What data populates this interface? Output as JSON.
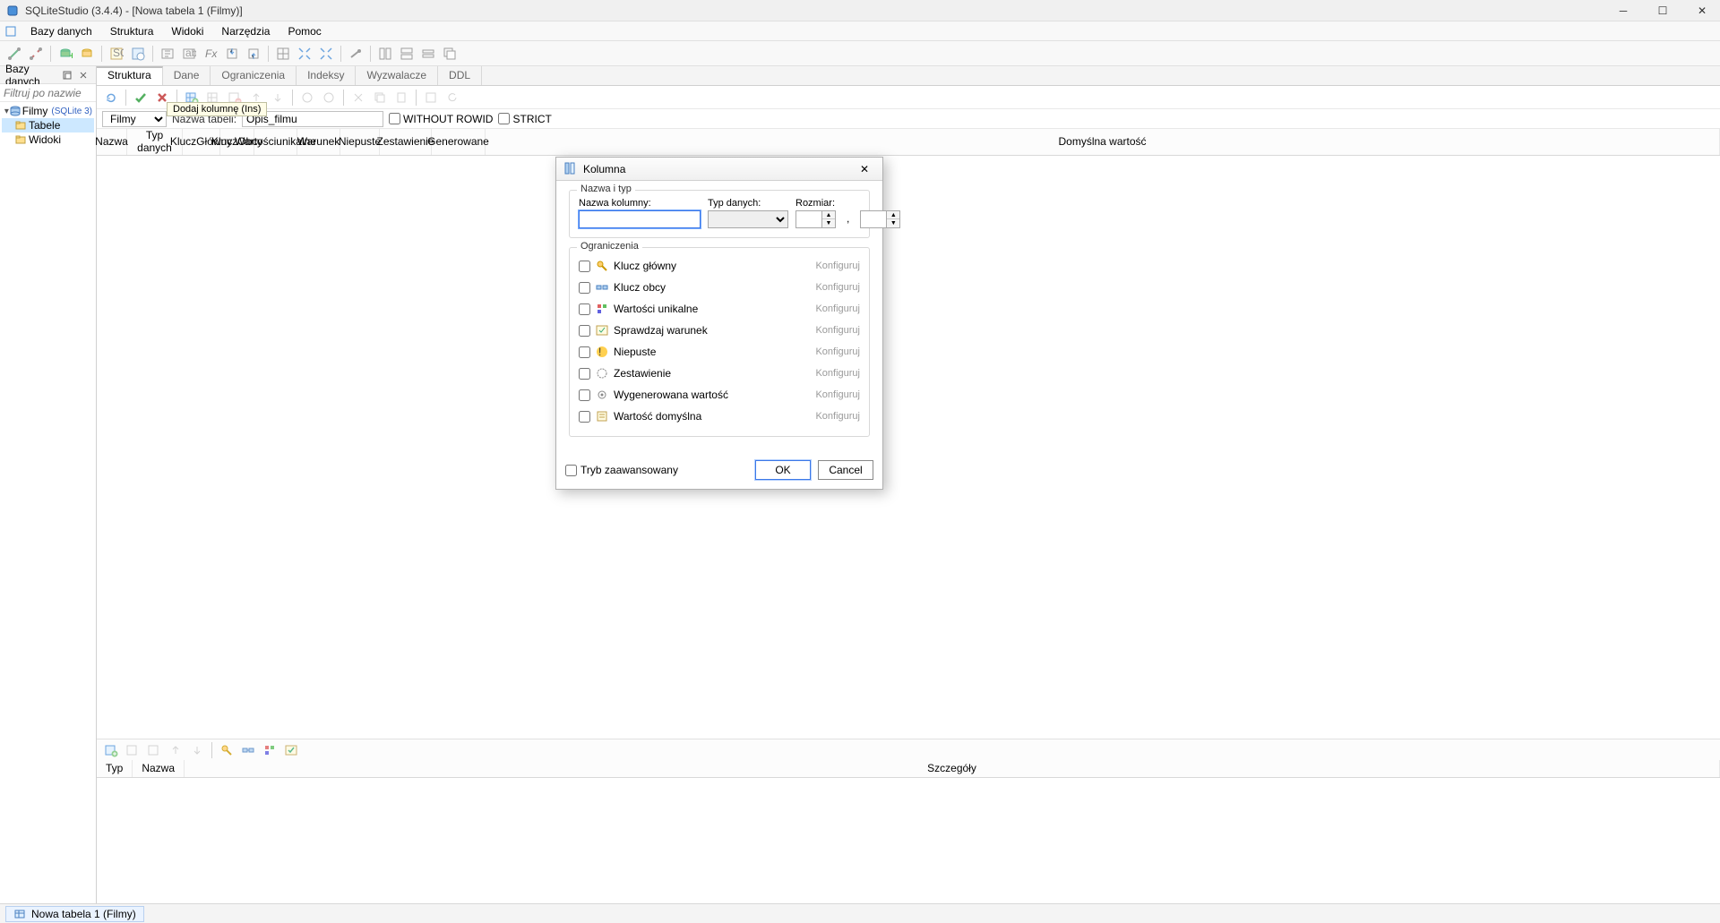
{
  "window": {
    "title": "SQLiteStudio (3.4.4) - [Nowa tabela 1 (Filmy)]"
  },
  "menu": {
    "items": [
      "Bazy danych",
      "Struktura",
      "Widoki",
      "Narzędzia",
      "Pomoc"
    ]
  },
  "sidebar": {
    "title": "Bazy danych",
    "filter_placeholder": "Filtruj po nazwie",
    "db_name": "Filmy",
    "db_type": "(SQLite 3)",
    "node_tables": "Tabele",
    "node_views": "Widoki"
  },
  "editor": {
    "tabs": [
      "Struktura",
      "Dane",
      "Ograniczenia",
      "Indeksy",
      "Wyzwalacze",
      "DDL"
    ],
    "tooltip": "Dodaj kolumnę (Ins)",
    "db_select": "Filmy",
    "table_name_label": "Nazwa tabeli:",
    "table_name_value": "Opis_filmu",
    "without_rowid": "WITHOUT ROWID",
    "strict": "STRICT",
    "col_headers": {
      "nazwa": "Nazwa",
      "typ": "Typ danych",
      "klucz_glowny_1": "Klucz",
      "klucz_glowny_2": "Główny",
      "klucz_obcy_1": "Klucz",
      "klucz_obcy_2": "Obcy",
      "wartosci_1": "Wartości",
      "wartosci_2": "unikalne",
      "warunek": "Warunek",
      "niepuste": "Niepuste",
      "zestawienie": "Zestawienie",
      "generowane": "Generowane",
      "domyslna": "Domyślna wartość"
    },
    "constraints_header": {
      "typ": "Typ",
      "nazwa": "Nazwa",
      "szczegoly": "Szczegóły"
    }
  },
  "dialog": {
    "title": "Kolumna",
    "group_name_type": "Nazwa i typ",
    "label_name": "Nazwa kolumny:",
    "label_type": "Typ danych:",
    "label_size": "Rozmiar:",
    "size_sep": ",",
    "group_constraints": "Ograniczenia",
    "constraints": [
      "Klucz główny",
      "Klucz obcy",
      "Wartości unikalne",
      "Sprawdzaj warunek",
      "Niepuste",
      "Zestawienie",
      "Wygenerowana wartość",
      "Wartość domyślna"
    ],
    "configure": "Konfiguruj",
    "advanced": "Tryb zaawansowany",
    "ok": "OK",
    "cancel": "Cancel"
  },
  "taskbar": {
    "item": "Nowa tabela 1 (Filmy)"
  }
}
